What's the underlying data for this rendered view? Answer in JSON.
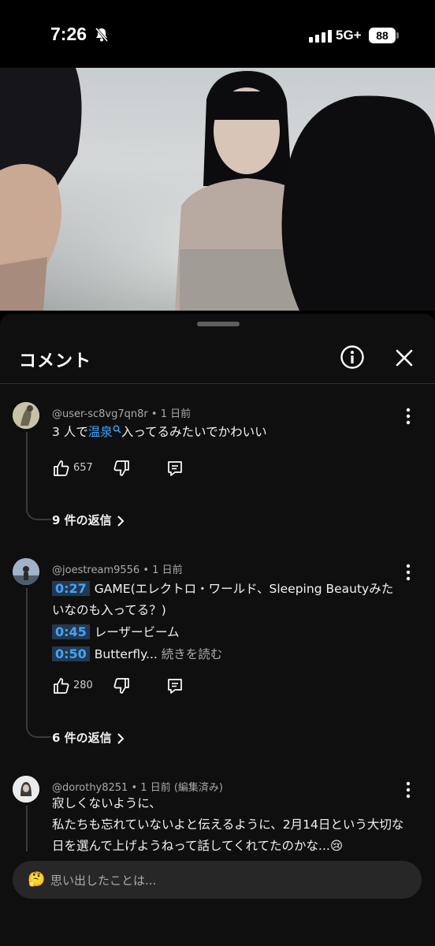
{
  "status": {
    "time": "7:26",
    "network": "5G+",
    "battery": "88"
  },
  "sheet": {
    "title": "コメント",
    "info_icon": "info-icon",
    "close_icon": "close-icon"
  },
  "comments": [
    {
      "user": "@user-sc8vg7qn8r",
      "time": "1 日前",
      "text_before": "3 人で",
      "link_text": "温泉",
      "text_after": "入ってるみたいでかわいい",
      "likes": "657",
      "replies_label": "9 件の返信"
    },
    {
      "user": "@joestream9556",
      "time": "1 日前",
      "lines": [
        {
          "ts": "0:27",
          "text": "GAME(エレクトロ・ワールド、Sleeping Beautyみた"
        },
        {
          "ts": "",
          "text": "いなのも入ってる？)"
        },
        {
          "ts": "0:45",
          "text": "レーザービーム"
        },
        {
          "ts": "0:50",
          "text": "Butterfly..."
        }
      ],
      "read_more": "続きを読む",
      "likes": "280",
      "replies_label": "6 件の返信"
    },
    {
      "user": "@dorothy8251",
      "time": "1 日前 (編集済み)",
      "lines": [
        "寂しくないように、",
        "私たちも忘れていないよと伝えるように、2月14日という大切な",
        "日を選んで上げようねって話してくれてたのかな...😢"
      ]
    }
  ],
  "input": {
    "placeholder": "思い出したことは...",
    "emoji": "🤔"
  },
  "colors": {
    "accent_link": "#3ea6ff",
    "sheet_bg": "#0f0f0f",
    "input_bg": "#272727"
  }
}
